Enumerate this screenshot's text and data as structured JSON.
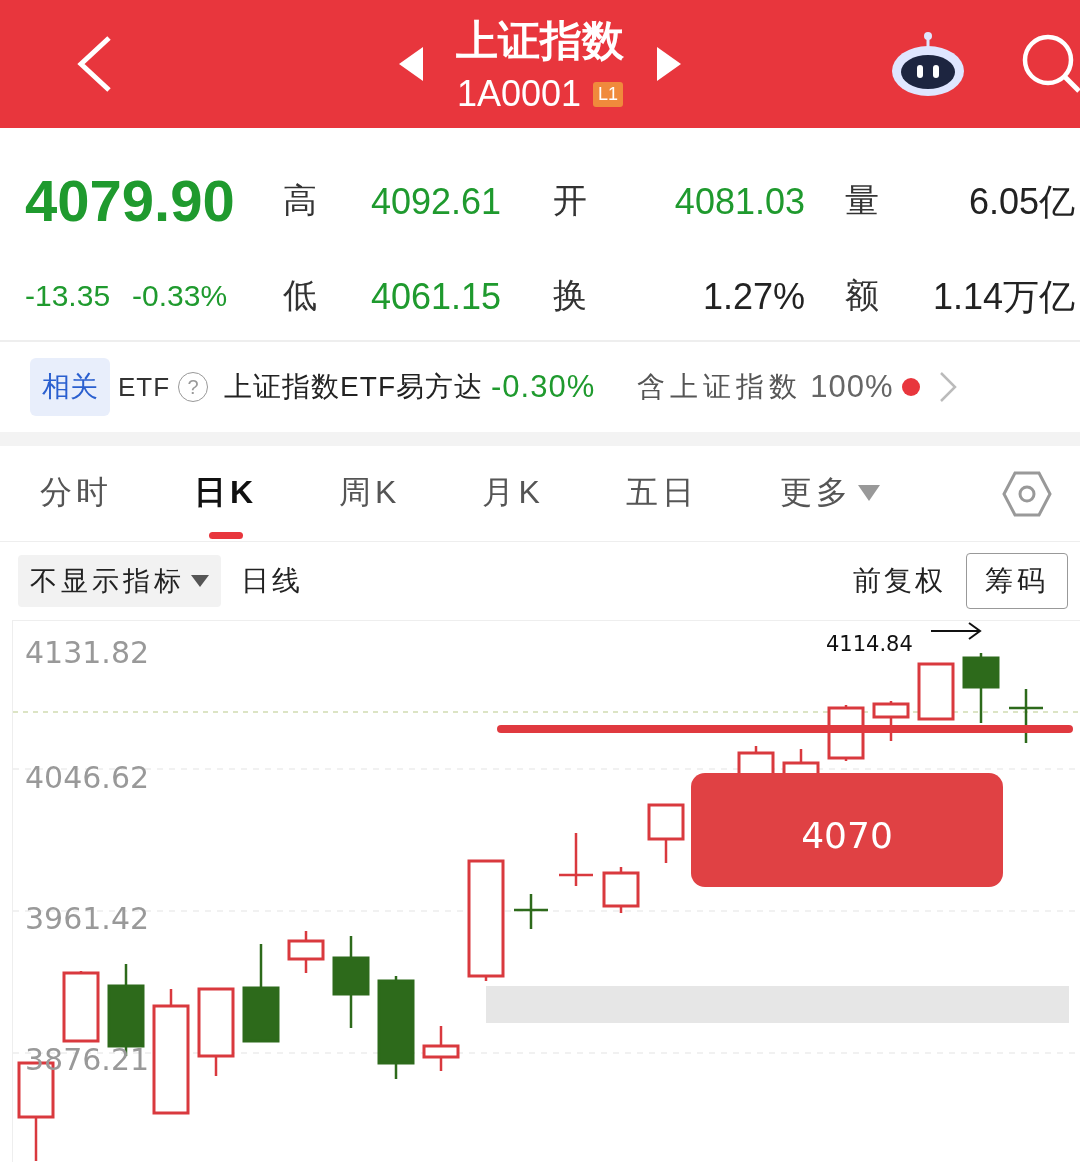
{
  "header": {
    "title": "上证指数",
    "code": "1A0001",
    "level_badge": "L1"
  },
  "quote": {
    "price": "4079.90",
    "change": "-13.35",
    "change_pct": "-0.33%",
    "stats": [
      {
        "label": "高",
        "value": "4092.61",
        "falling": true
      },
      {
        "label": "开",
        "value": "4081.03",
        "falling": true
      },
      {
        "label": "量",
        "value": "6.05亿",
        "falling": false
      },
      {
        "label": "低",
        "value": "4061.15",
        "falling": true
      },
      {
        "label": "换",
        "value": "1.27%",
        "falling": false
      },
      {
        "label": "额",
        "value": "1.14万亿",
        "falling": false
      }
    ]
  },
  "etf": {
    "tag": "相关",
    "label": "ETF",
    "help": "?",
    "name": "上证指数ETF易方达",
    "change": "-0.30%",
    "holding_label": "含上证指数",
    "holding_value": "100%"
  },
  "tabs": [
    {
      "label": "分时",
      "selected": false,
      "kind": "plain"
    },
    {
      "label": "日K",
      "selected": true,
      "kind": "plain"
    },
    {
      "label": "周K",
      "selected": false,
      "kind": "plain"
    },
    {
      "label": "月K",
      "selected": false,
      "kind": "plain"
    },
    {
      "label": "五日",
      "selected": false,
      "kind": "plain"
    },
    {
      "label": "更多",
      "selected": false,
      "kind": "dropdown"
    }
  ],
  "toolbar": {
    "indicator_select": "不显示指标",
    "line_type": "日线",
    "adjust": "前复权",
    "chips_button": "筹码"
  },
  "chart": {
    "y_labels": [
      "4131.82",
      "4046.62",
      "3961.42",
      "3876.21"
    ],
    "high_note": "4114.84",
    "price_tag": "4070"
  }
}
